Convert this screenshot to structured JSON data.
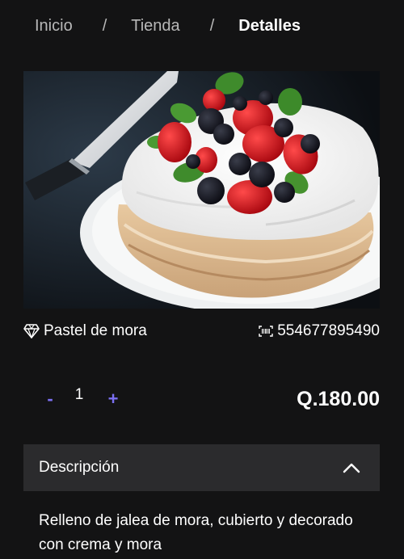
{
  "breadcrumb": {
    "items": [
      {
        "label": "Inicio"
      },
      {
        "label": "Tienda"
      },
      {
        "label": "Detalles"
      }
    ],
    "separator": "/"
  },
  "product": {
    "image_icon": "pavlova-cake-photo",
    "name_icon": "diamond-icon",
    "name": "Pastel de mora",
    "sku_icon": "barcode-icon",
    "sku": "554677895490",
    "quantity": {
      "minus_label": "-",
      "value": "1",
      "plus_label": "+"
    },
    "price": "Q.180.00"
  },
  "description": {
    "title": "Descripción",
    "toggle_icon": "chevron-up-icon",
    "expanded": true,
    "text": "Relleno de jalea de mora, cubierto y decorado con crema y mora"
  },
  "colors": {
    "background": "#131314",
    "accent": "#7b6ff2",
    "accordion_bg": "#2b2b2d",
    "muted_text": "#b8b8b8"
  }
}
